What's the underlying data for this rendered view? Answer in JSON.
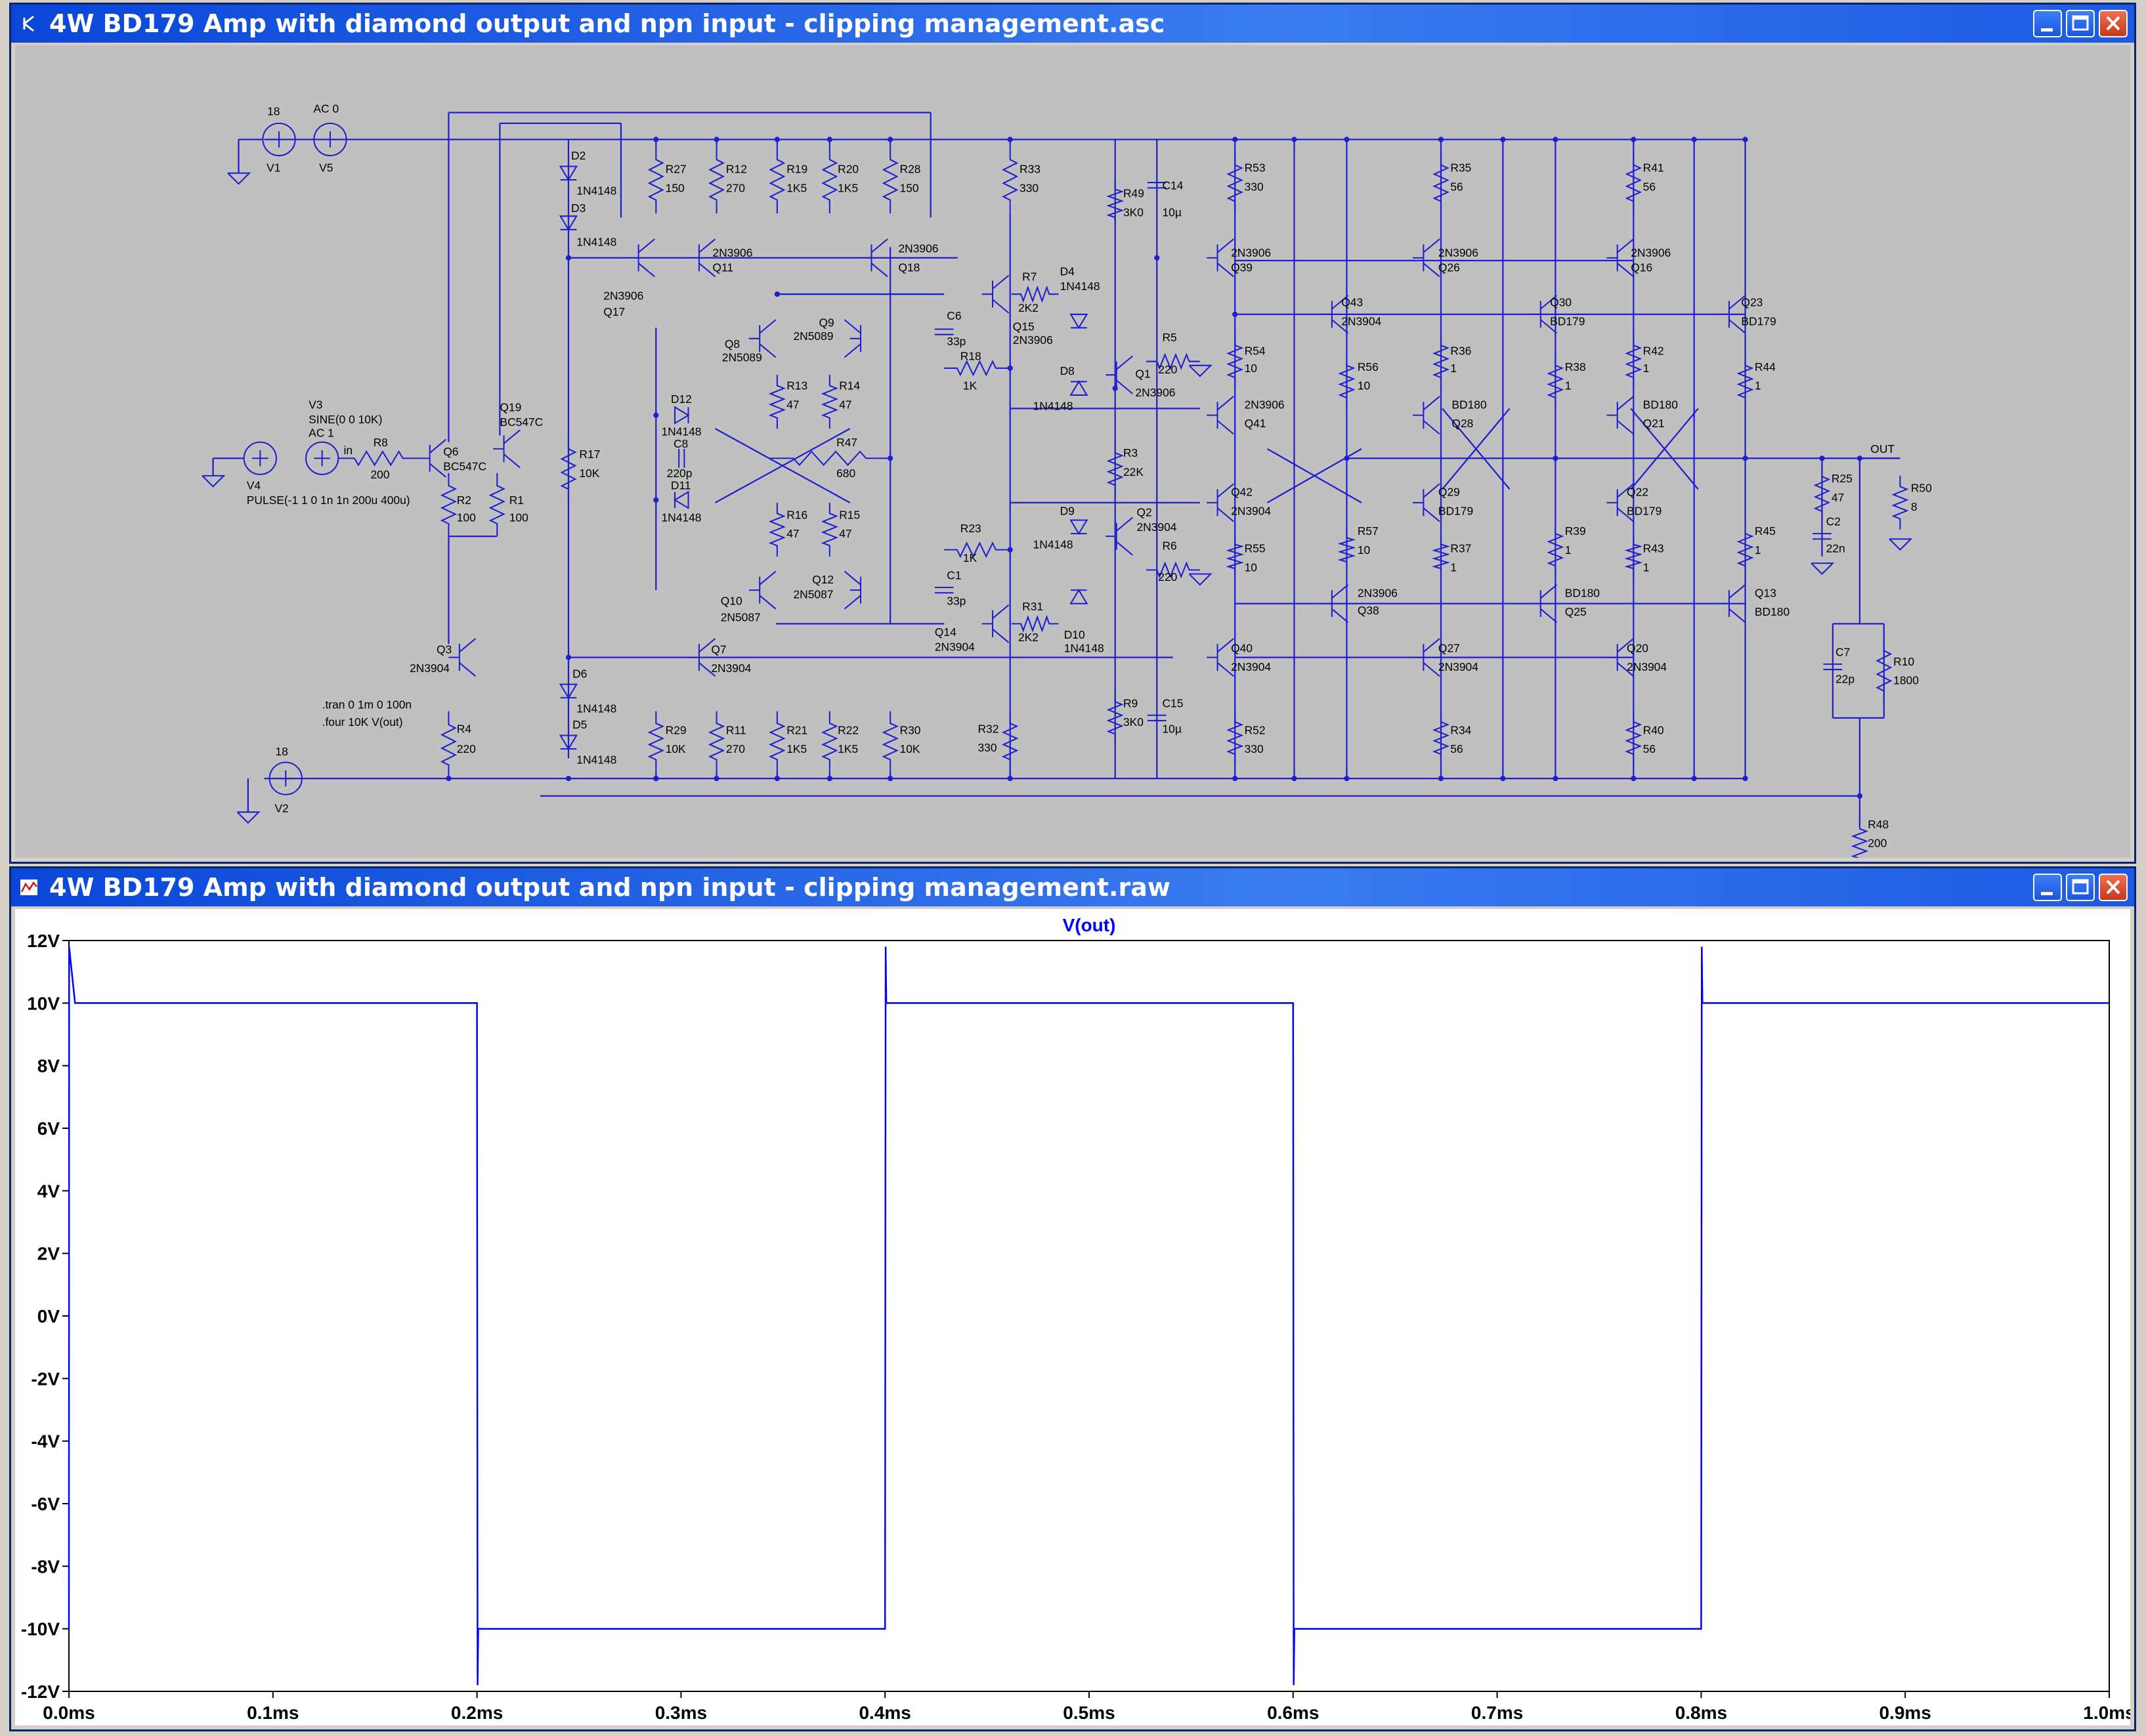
{
  "schematic_window": {
    "title": "4W BD179 Amp with diamond output and npn input - clipping management.asc",
    "icon": "schematic-icon",
    "labels": {
      "v1_val": "18",
      "v1_name": "V1",
      "v5_val": "AC 0",
      "v5_name": "V5",
      "v2_val": "18",
      "v2_name": "V2",
      "v3_line1": "V3",
      "v3_line2": "SINE(0 0 10K)",
      "v3_line3": "AC 1",
      "v4_name": "V4",
      "v4_pulse": "PULSE(-1 1 0 1n 1n 200u 400u)",
      "in_label": "in",
      "r8": "R8",
      "r8v": "200",
      "q6": "Q6",
      "q6t": "BC547C",
      "q19": "Q19",
      "q19t": "BC547C",
      "r2": "R2",
      "r2v": "100",
      "r1": "R1",
      "r1v": "100",
      "q3": "Q3",
      "q3t": "2N3904",
      "r4": "R4",
      "r4v": "220",
      "tran": ".tran 0 1m 0 100n",
      "four": ".four 10K V(out)",
      "d2": "D2",
      "d2t": "1N4148",
      "d3": "D3",
      "d3t": "1N4148",
      "d6": "D6",
      "d6t": "1N4148",
      "d5": "D5",
      "d5t": "1N4148",
      "r17": "R17",
      "r17v": "10K",
      "r27": "R27",
      "r27v": "150",
      "r12": "R12",
      "r12v": "270",
      "r19": "R19",
      "r19v": "1K5",
      "r20": "R20",
      "r20v": "1K5",
      "r28": "R28",
      "r28v": "150",
      "r33": "R33",
      "r33v": "330",
      "q17": "Q17",
      "q17t": "2N3906",
      "q11": "Q11",
      "q11t": "2N3906",
      "q18": "Q18",
      "q18t": "2N3906",
      "q8": "Q8",
      "q8t": "2N5089",
      "q9": "Q9",
      "q9t": "2N5089",
      "r13": "R13",
      "r13v": "47",
      "r14": "R14",
      "r14v": "47",
      "d12": "D12",
      "d12t": "1N4148",
      "c8": "C8",
      "c8v": "220p",
      "d11": "D11",
      "d11t": "1N4148",
      "r47": "R47",
      "r47v": "680",
      "r16": "R16",
      "r16v": "47",
      "r15": "R15",
      "r15v": "47",
      "q10": "Q10",
      "q10t": "2N5087",
      "q12": "Q12",
      "q12t": "2N5087",
      "q7": "Q7",
      "q7t": "2N3904",
      "r29": "R29",
      "r29v": "10K",
      "r11": "R11",
      "r11v": "270",
      "r21": "R21",
      "r21v": "1K5",
      "r22": "R22",
      "r22v": "1K5",
      "r30": "R30",
      "r30v": "10K",
      "r32": "R32",
      "r32v": "330",
      "c6": "C6",
      "c6v": "33p",
      "r18": "R18",
      "r18v": "1K",
      "q15": "Q15",
      "q15t": "2N3906",
      "r7": "R7",
      "r7v": "2K2",
      "d4": "D4",
      "d4t": "1N4148",
      "d8": "D8",
      "d8t": "1N4148",
      "q1": "Q1",
      "q1t": "2N3906",
      "r5": "R5",
      "r5v": "220",
      "r49": "R49",
      "r49v": "3K0",
      "c14": "C14",
      "c14v": "10µ",
      "r3": "R3",
      "r3v": "22K",
      "d9": "D9",
      "d9t": "1N4148",
      "q2": "Q2",
      "q2t": "2N3904",
      "r6": "R6",
      "r6v": "220",
      "r23": "R23",
      "r23v": "1K",
      "c1": "C1",
      "c1v": "33p",
      "q14": "Q14",
      "q14t": "2N3904",
      "r31": "R31",
      "r31v": "2K2",
      "d10": "D10",
      "d10t": "1N4148",
      "r9": "R9",
      "r9v": "3K0",
      "c15": "C15",
      "c15v": "10µ",
      "r53": "R53",
      "r53v": "330",
      "q39": "Q39",
      "q39t": "2N3906",
      "r54": "R54",
      "r54v": "10",
      "q41": "Q41",
      "q41t": "2N3906",
      "q42": "Q42",
      "q42t": "2N3904",
      "r55": "R55",
      "r55v": "10",
      "q40": "Q40",
      "q40t": "2N3904",
      "r52": "R52",
      "r52v": "330",
      "q43": "Q43",
      "q43t": "2N3904",
      "r56": "R56",
      "r56v": "10",
      "r57": "R57",
      "r57v": "10",
      "q38": "Q38",
      "q38t": "2N3906",
      "r35": "R35",
      "r35v": "56",
      "q26": "Q26",
      "q26t": "2N3906",
      "r36": "R36",
      "r36v": "1",
      "q28": "Q28",
      "q28t": "BD180",
      "q29": "Q29",
      "q29t": "BD179",
      "r37": "R37",
      "r37v": "1",
      "q27": "Q27",
      "q27t": "2N3904",
      "r34": "R34",
      "r34v": "56",
      "q30": "Q30",
      "q30t": "BD179",
      "r38": "R38",
      "r38v": "1",
      "r39": "R39",
      "r39v": "1",
      "q25": "Q25",
      "q25t": "BD180",
      "r41": "R41",
      "r41v": "56",
      "q16": "Q16",
      "q16t": "2N3906",
      "r42": "R42",
      "r42v": "1",
      "q21": "Q21",
      "q21t": "BD180",
      "q22": "Q22",
      "q22t": "BD179",
      "r43": "R43",
      "r43v": "1",
      "q20": "Q20",
      "q20t": "2N3904",
      "r40": "R40",
      "r40v": "56",
      "q23": "Q23",
      "q23t": "BD179",
      "r44": "R44",
      "r44v": "1",
      "r45": "R45",
      "r45v": "1",
      "q13": "Q13",
      "q13t": "BD180",
      "out": "OUT",
      "r25": "R25",
      "r25v": "47",
      "c2": "C2",
      "c2v": "22n",
      "r50": "R50",
      "r50v": "8",
      "c7": "C7",
      "c7v": "22p",
      "r10": "R10",
      "r10v": "1800",
      "r48": "R48",
      "r48v": "200"
    }
  },
  "waveform_window": {
    "title": "4W BD179 Amp with diamond output and npn input - clipping management.raw",
    "icon": "waveform-icon",
    "trace_color": "#0000ff"
  },
  "chart_data": {
    "type": "line",
    "title": "",
    "series": [
      {
        "name": "V(out)",
        "x": [
          0.0,
          0.0001,
          0.003,
          0.2,
          0.2003,
          0.2006,
          0.4,
          0.4003,
          0.4006,
          0.6,
          0.6003,
          0.6006,
          0.8,
          0.8003,
          0.8006,
          1.0
        ],
        "y": [
          -10.0,
          11.8,
          10.0,
          10.0,
          -11.8,
          -10.0,
          -10.0,
          11.8,
          10.0,
          10.0,
          -11.8,
          -10.0,
          -10.0,
          11.8,
          10.0,
          10.0
        ]
      }
    ],
    "x_unit": "ms",
    "y_unit": "V",
    "xlim": [
      0.0,
      1.0
    ],
    "ylim": [
      -12,
      12
    ],
    "x_ticks": [
      "0.0ms",
      "0.1ms",
      "0.2ms",
      "0.3ms",
      "0.4ms",
      "0.5ms",
      "0.6ms",
      "0.7ms",
      "0.8ms",
      "0.9ms",
      "1.0ms"
    ],
    "y_ticks": [
      "12V",
      "10V",
      "8V",
      "6V",
      "4V",
      "2V",
      "0V",
      "-2V",
      "-4V",
      "-6V",
      "-8V",
      "-10V",
      "-12V"
    ],
    "grid": true,
    "legend": "top-center"
  }
}
